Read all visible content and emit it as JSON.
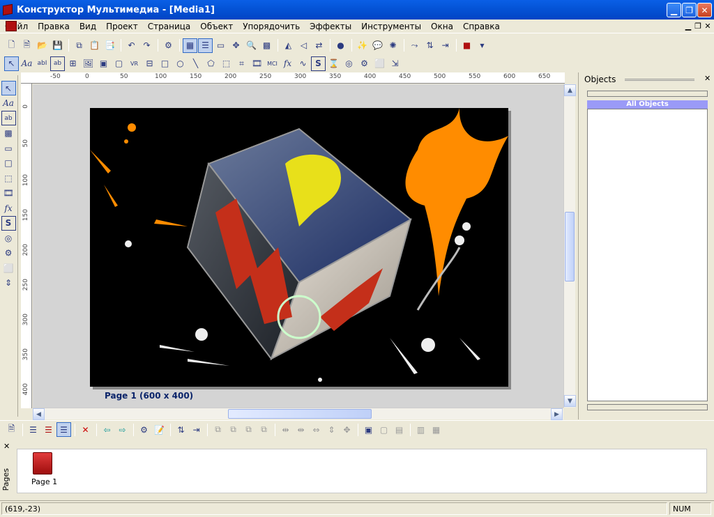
{
  "window": {
    "title": "Конструктор Мультимедиа - [Media1]"
  },
  "menu": [
    "Файл",
    "Правка",
    "Вид",
    "Проект",
    "Страница",
    "Объект",
    "Упорядочить",
    "Эффекты",
    "Инструменты",
    "Окна",
    "Справка"
  ],
  "ruler": {
    "h_ticks": [
      "-50",
      "0",
      "50",
      "100",
      "150",
      "200",
      "250",
      "300",
      "350",
      "400",
      "450",
      "500",
      "550",
      "600",
      "650"
    ],
    "v_ticks": [
      "0",
      "50",
      "100",
      "150",
      "200",
      "250",
      "300",
      "350",
      "400"
    ]
  },
  "tools": {
    "text_tool": "Aa",
    "fx_tool": "fx",
    "s_tool": "S"
  },
  "canvas": {
    "page_label": "Page 1 (600 x 400)"
  },
  "objects_panel": {
    "title": "Objects",
    "tab": "All Objects"
  },
  "pages_panel": {
    "title": "Pages",
    "items": [
      {
        "label": "Page 1"
      }
    ]
  },
  "status": {
    "coords": "(619,-23)",
    "num": "NUM"
  },
  "colors": {
    "accent": "#0a246a",
    "selection": "#9a9af7",
    "paint": "#ff8c00"
  }
}
